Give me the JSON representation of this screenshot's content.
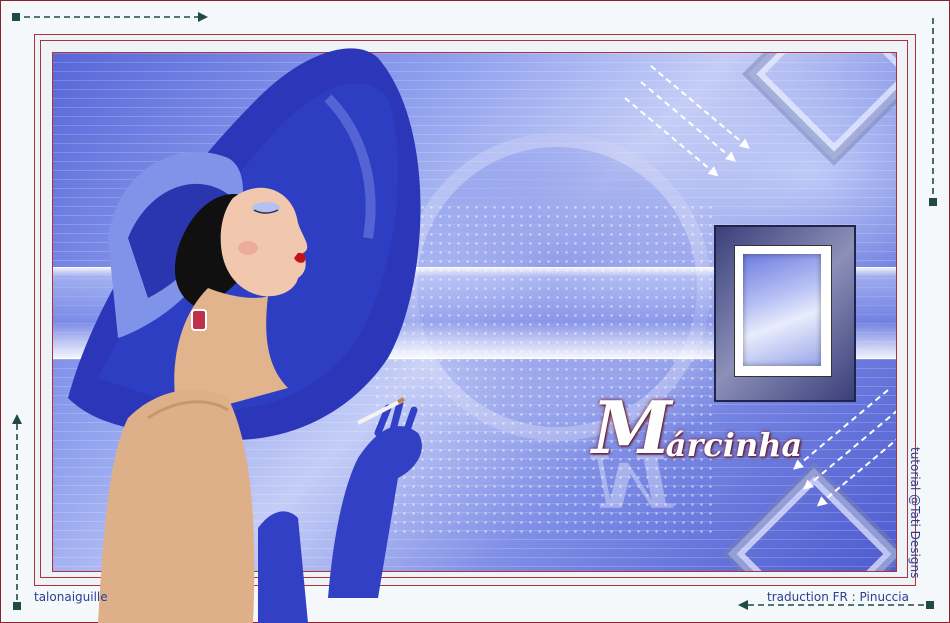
{
  "signature": {
    "initial": "M",
    "rest": "árcinha"
  },
  "credits": {
    "left": "talonaiguille",
    "right": "traduction FR : Pinuccia",
    "vertical": "tutorial @Tati Designs"
  },
  "colors": {
    "frame": "#b0303c",
    "background_blue": "#5866d8",
    "credit_text": "#2a3f8f",
    "arrow": "#1f4a45"
  },
  "icons": [
    "arrow-right-icon",
    "arrow-down-icon",
    "arrow-up-icon",
    "arrow-left-icon"
  ]
}
